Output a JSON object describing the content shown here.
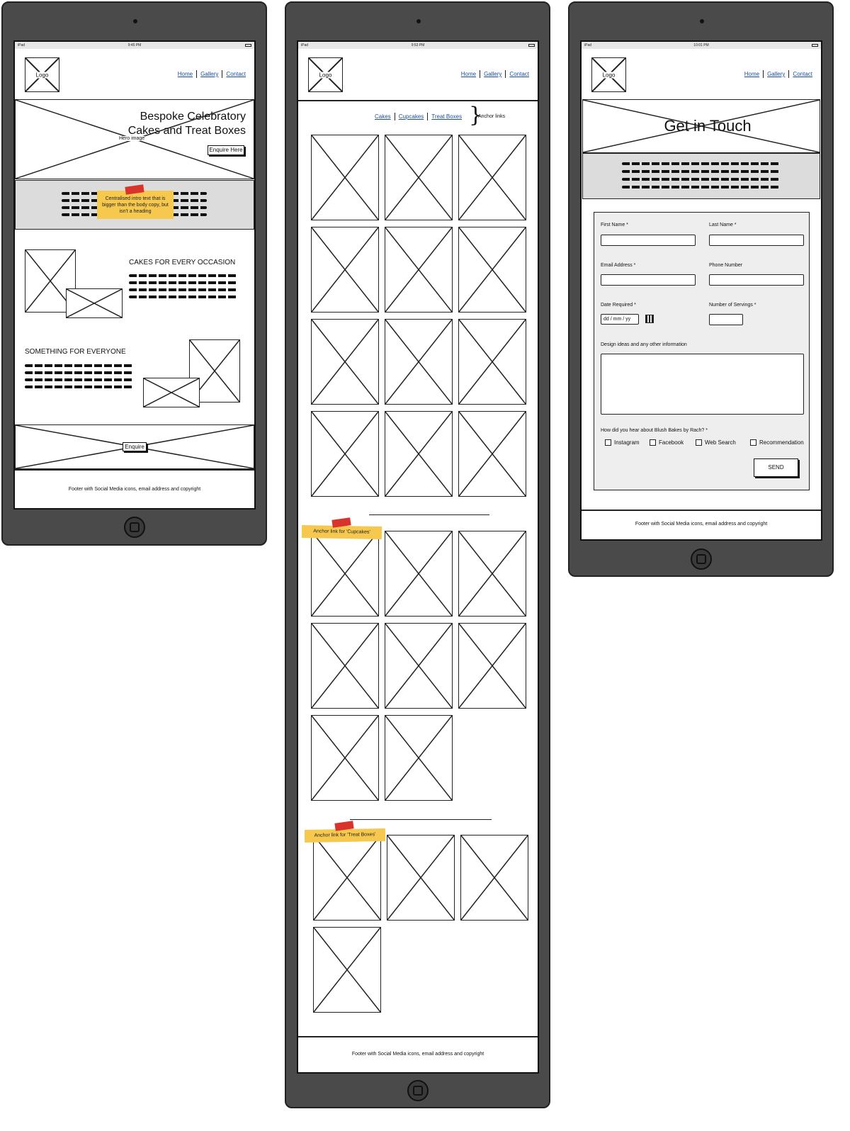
{
  "status_bar": {
    "device": "iPad",
    "time_home": "9:45 PM",
    "time_gallery": "9:53 PM",
    "time_contact": "10:01 PM"
  },
  "nav": {
    "logo": "Logo",
    "home": "Home",
    "gallery": "Gallery",
    "contact": "Contact"
  },
  "home": {
    "hero_title_line1": "Bespoke Celebratory",
    "hero_title_line2": "Cakes and Treat Boxes",
    "hero_image_label": "Hero image",
    "enquire_here": "Enquire Here",
    "intro_note": "Centralised intro text that is bigger than the body copy, but isn't a heading",
    "section1_heading": "CAKES FOR EVERY OCCASION",
    "section2_heading": "SOMETHING FOR EVERYONE",
    "enquire": "Enquire",
    "footer": "Footer with Social Media icons, email address and copyright"
  },
  "gallery": {
    "anchors": [
      "Cakes",
      "Cupcakes",
      "Treat Boxes"
    ],
    "anchor_note": "Anchor links",
    "note_cupcakes": "Anchor link for 'Cupcakes'",
    "note_treatboxes": "Anchor link for 'Treat Boxes'",
    "footer": "Footer with Social Media icons, email address and copyright"
  },
  "contact": {
    "title": "Get in Touch",
    "first_name": "First Name *",
    "last_name": "Last Name *",
    "email": "Email Address *",
    "phone": "Phone Number",
    "date": "Date Required *",
    "date_placeholder": "dd / mm / yy",
    "servings": "Number of Servings *",
    "design": "Design ideas and any other information",
    "hear": "How did you hear about Blush Bakes by Rach? *",
    "options": [
      "Instagram",
      "Facebook",
      "Web Search",
      "Recommendation"
    ],
    "send": "SEND",
    "footer": "Footer with Social Media icons, email address and copyright"
  }
}
